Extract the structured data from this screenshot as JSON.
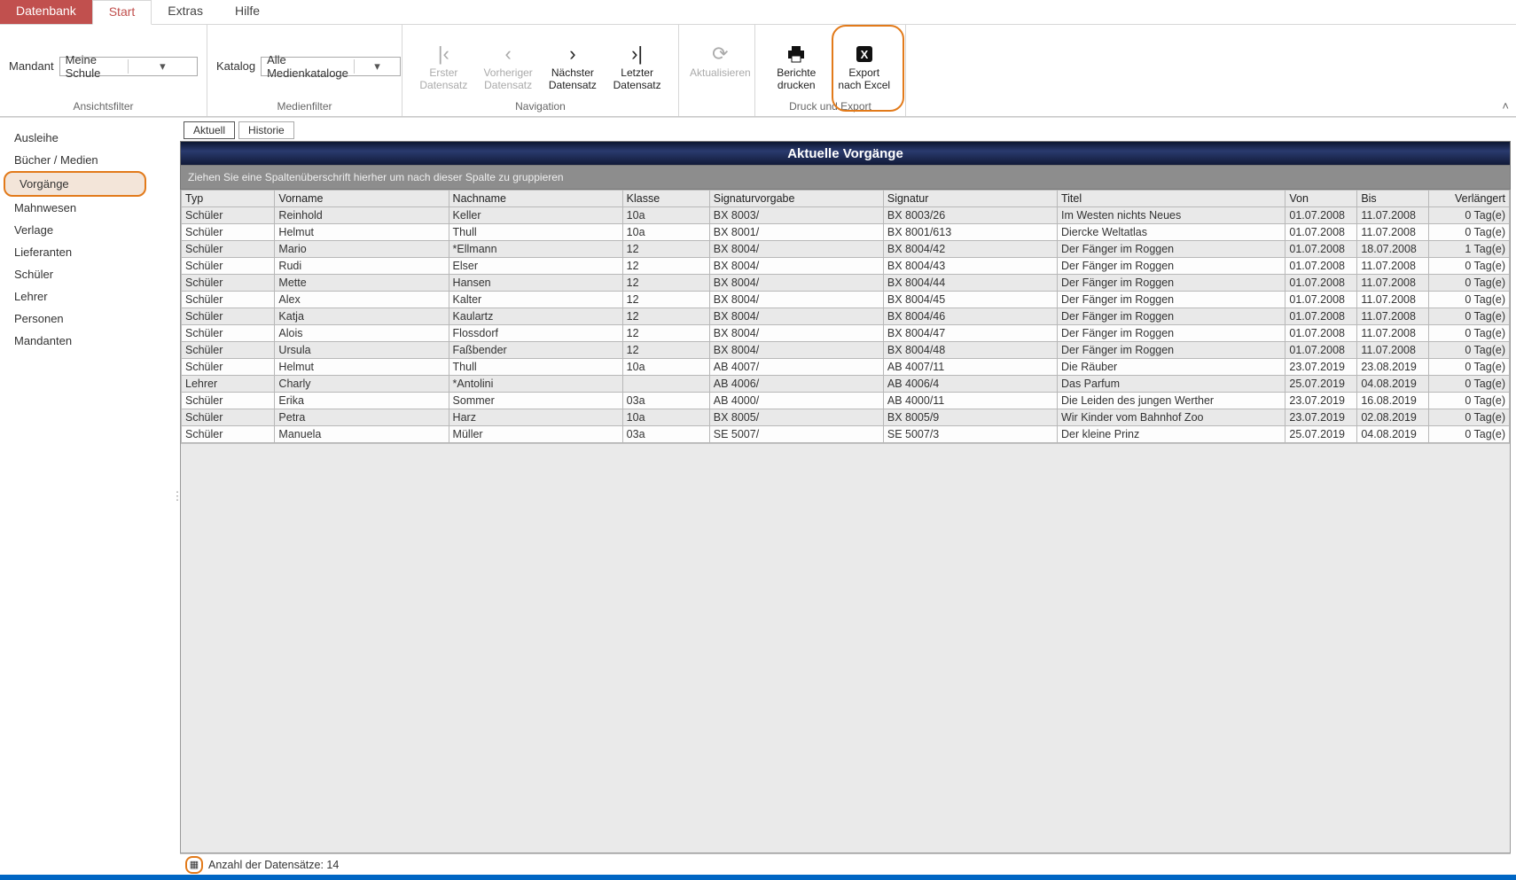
{
  "menubar": {
    "tabs": [
      "Datenbank",
      "Start",
      "Extras",
      "Hilfe"
    ],
    "active_index": 1
  },
  "ribbon": {
    "groups": {
      "ansicht": {
        "label": "Ansichtsfilter",
        "field_label": "Mandant",
        "field_value": "Meine Schule"
      },
      "medien": {
        "label": "Medienfilter",
        "field_label": "Katalog",
        "field_value": "Alle Medienkataloge"
      },
      "navigation": {
        "label": "Navigation",
        "first": {
          "l1": "Erster",
          "l2": "Datensatz"
        },
        "prev": {
          "l1": "Vorheriger",
          "l2": "Datensatz"
        },
        "next": {
          "l1": "Nächster",
          "l2": "Datensatz"
        },
        "last": {
          "l1": "Letzter",
          "l2": "Datensatz"
        }
      },
      "refresh": {
        "l1": "Aktualisieren"
      },
      "export": {
        "label": "Druck und Export",
        "print": {
          "l1": "Berichte",
          "l2": "drucken"
        },
        "excel": {
          "l1": "Export",
          "l2": "nach Excel"
        }
      }
    }
  },
  "sidebar": {
    "items": [
      {
        "label": "Ausleihe"
      },
      {
        "label": "Bücher / Medien"
      },
      {
        "label": "Vorgänge"
      },
      {
        "label": "Mahnwesen"
      },
      {
        "label": "Verlage"
      },
      {
        "label": "Lieferanten"
      },
      {
        "label": "Schüler"
      },
      {
        "label": "Lehrer"
      },
      {
        "label": "Personen"
      },
      {
        "label": "Mandanten"
      }
    ],
    "selected_index": 2
  },
  "subtabs": {
    "items": [
      "Aktuell",
      "Historie"
    ],
    "active_index": 0
  },
  "panel": {
    "title": "Aktuelle Vorgänge",
    "group_hint": "Ziehen Sie eine Spaltenüberschrift hierher um nach dieser Spalte zu gruppieren"
  },
  "columns": [
    "Typ",
    "Vorname",
    "Nachname",
    "Klasse",
    "Signaturvorgabe",
    "Signatur",
    "Titel",
    "Von",
    "Bis",
    "Verlängert"
  ],
  "rows": [
    [
      "Schüler",
      "Reinhold",
      "Keller",
      "10a",
      "BX 8003/",
      "BX 8003/26",
      "Im Westen nichts Neues",
      "01.07.2008",
      "11.07.2008",
      "0 Tag(e)"
    ],
    [
      "Schüler",
      "Helmut",
      "Thull",
      "10a",
      "BX 8001/",
      "BX 8001/613",
      "Diercke Weltatlas",
      "01.07.2008",
      "11.07.2008",
      "0 Tag(e)"
    ],
    [
      "Schüler",
      "Mario",
      "*Ellmann",
      "12",
      "BX 8004/",
      "BX 8004/42",
      "Der Fänger im Roggen",
      "01.07.2008",
      "18.07.2008",
      "1 Tag(e)"
    ],
    [
      "Schüler",
      "Rudi",
      "Elser",
      "12",
      "BX 8004/",
      "BX 8004/43",
      "Der Fänger im Roggen",
      "01.07.2008",
      "11.07.2008",
      "0 Tag(e)"
    ],
    [
      "Schüler",
      "Mette",
      "Hansen",
      "12",
      "BX 8004/",
      "BX 8004/44",
      "Der Fänger im Roggen",
      "01.07.2008",
      "11.07.2008",
      "0 Tag(e)"
    ],
    [
      "Schüler",
      "Alex",
      "Kalter",
      "12",
      "BX 8004/",
      "BX 8004/45",
      "Der Fänger im Roggen",
      "01.07.2008",
      "11.07.2008",
      "0 Tag(e)"
    ],
    [
      "Schüler",
      "Katja",
      "Kaulartz",
      "12",
      "BX 8004/",
      "BX 8004/46",
      "Der Fänger im Roggen",
      "01.07.2008",
      "11.07.2008",
      "0 Tag(e)"
    ],
    [
      "Schüler",
      "Alois",
      "Flossdorf",
      "12",
      "BX 8004/",
      "BX 8004/47",
      "Der Fänger im Roggen",
      "01.07.2008",
      "11.07.2008",
      "0 Tag(e)"
    ],
    [
      "Schüler",
      "Ursula",
      "Faßbender",
      "12",
      "BX 8004/",
      "BX 8004/48",
      "Der Fänger im Roggen",
      "01.07.2008",
      "11.07.2008",
      "0 Tag(e)"
    ],
    [
      "Schüler",
      "Helmut",
      "Thull",
      "10a",
      "AB 4007/",
      "AB 4007/11",
      "Die Räuber",
      "23.07.2019",
      "23.08.2019",
      "0 Tag(e)"
    ],
    [
      "Lehrer",
      "Charly",
      "*Antolini",
      "",
      "AB 4006/",
      "AB 4006/4",
      "Das Parfum",
      "25.07.2019",
      "04.08.2019",
      "0 Tag(e)"
    ],
    [
      "Schüler",
      "Erika",
      "Sommer",
      "03a",
      "AB 4000/",
      "AB 4000/11",
      "Die Leiden des jungen Werther",
      "23.07.2019",
      "16.08.2019",
      "0 Tag(e)"
    ],
    [
      "Schüler",
      "Petra",
      "Harz",
      "10a",
      "BX 8005/",
      "BX 8005/9",
      "Wir Kinder vom Bahnhof Zoo",
      "23.07.2019",
      "02.08.2019",
      "0 Tag(e)"
    ],
    [
      "Schüler",
      "Manuela",
      "Müller",
      "03a",
      "SE 5007/",
      "SE 5007/3",
      "Der kleine Prinz",
      "25.07.2019",
      "04.08.2019",
      "0 Tag(e)"
    ]
  ],
  "status": {
    "text": "Anzahl der Datensätze:  14"
  }
}
